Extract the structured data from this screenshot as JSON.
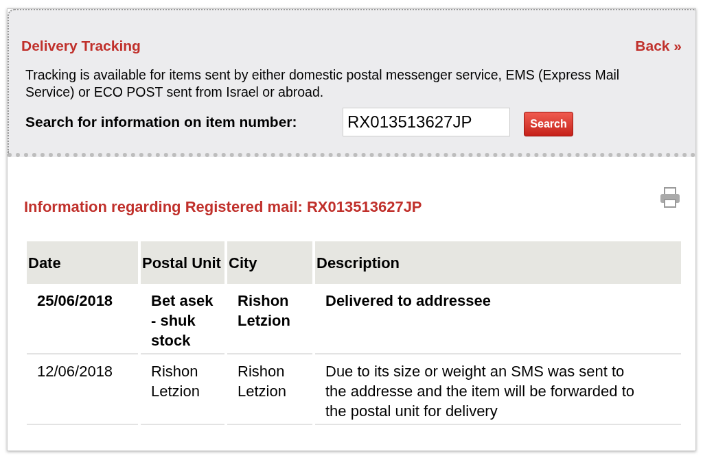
{
  "header": {
    "title": "Delivery Tracking",
    "back_link": "Back »",
    "intro": "Tracking is available for items sent by either domestic postal messenger service, EMS (Express Mail Service) or ECO POST sent from Israel or abroad.",
    "search": {
      "label": "Search for information on item number:",
      "value": "RX013513627JP",
      "button": "Search"
    }
  },
  "result": {
    "title": "Information regarding Registered mail: RX013513627JP",
    "table": {
      "columns": [
        "Date",
        "Postal Unit",
        "City",
        "Description"
      ],
      "rows": [
        {
          "bold": true,
          "cells": [
            "25/06/2018",
            "Bet asek - shuk stock",
            "Rishon Letzion",
            "Delivered to addressee"
          ]
        },
        {
          "bold": false,
          "cells": [
            "12/06/2018",
            "Rishon Letzion",
            "Rishon Letzion",
            "Due to its size or weight an SMS was sent to the addresse and the item will be forwarded to the postal unit for delivery"
          ]
        }
      ]
    }
  }
}
